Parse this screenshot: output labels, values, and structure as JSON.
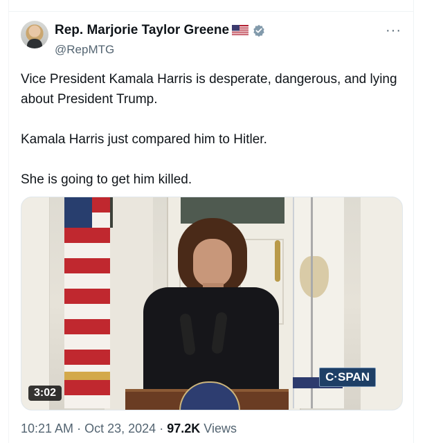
{
  "tweet": {
    "display_name": "Rep. Marjorie Taylor Greene",
    "handle": "@RepMTG",
    "more_menu": "···",
    "text_paragraphs": [
      "Vice President Kamala Harris is desperate, dangerous, and lying about President Trump.",
      "Kamala Harris just compared him to Hitler.",
      "She is going to get him killed."
    ],
    "media": {
      "duration": "3:02",
      "watermark": "C·SPAN"
    },
    "meta": {
      "time": "10:21 AM",
      "separator": "·",
      "date": "Oct 23, 2024",
      "views_count": "97.2K",
      "views_label": "Views"
    }
  },
  "icons": {
    "flag": "us-flag-emoji-icon",
    "verified": "verified-badge-icon",
    "more": "more-icon"
  },
  "colors": {
    "text_primary": "#0f1419",
    "text_secondary": "#536471",
    "verified_gray": "#829aab"
  }
}
